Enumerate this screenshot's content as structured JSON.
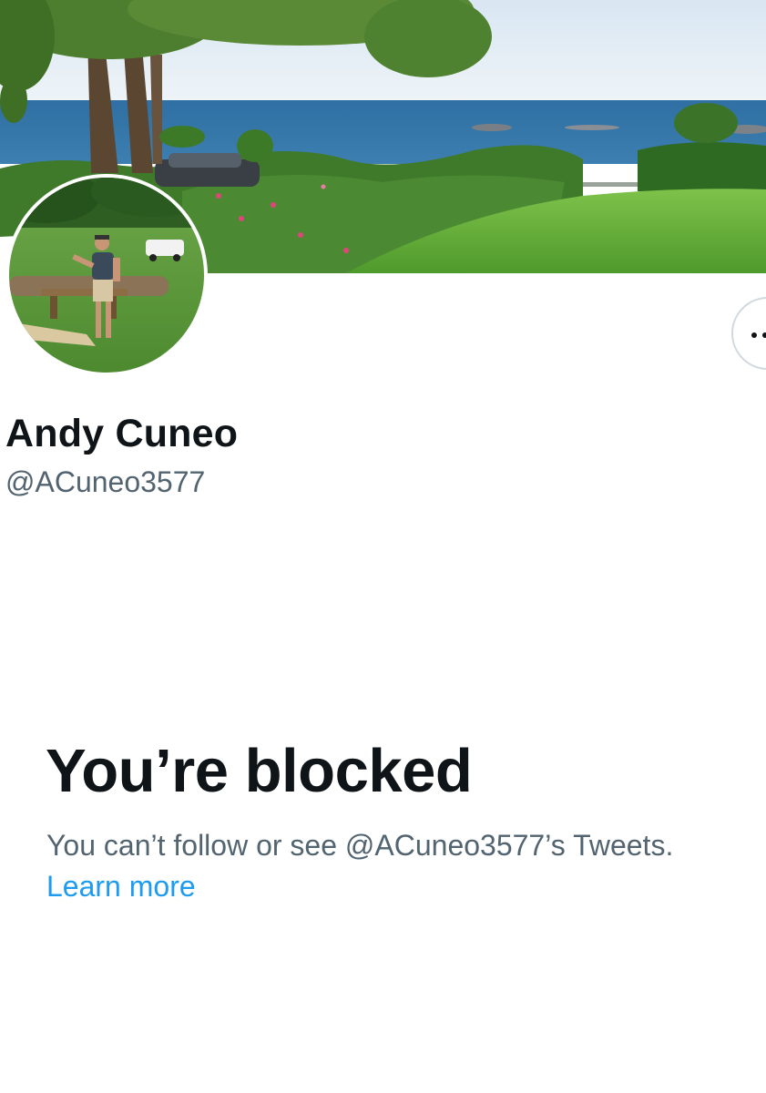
{
  "profile": {
    "display_name": "Andy Cuneo",
    "handle": "@ACuneo3577",
    "banner_description": "header-photo",
    "avatar_description": "profile-photo"
  },
  "actions": {
    "more_icon": "more-horizontal-icon"
  },
  "blocked_notice": {
    "title": "You’re blocked",
    "description": "You can’t follow or see @ACuneo3577’s Tweets.",
    "link_label": "Learn more"
  },
  "colors": {
    "primary_text": "#0f1419",
    "secondary_text": "#536471",
    "link": "#1d9bf0",
    "border": "#cfd9de",
    "background": "#ffffff"
  }
}
